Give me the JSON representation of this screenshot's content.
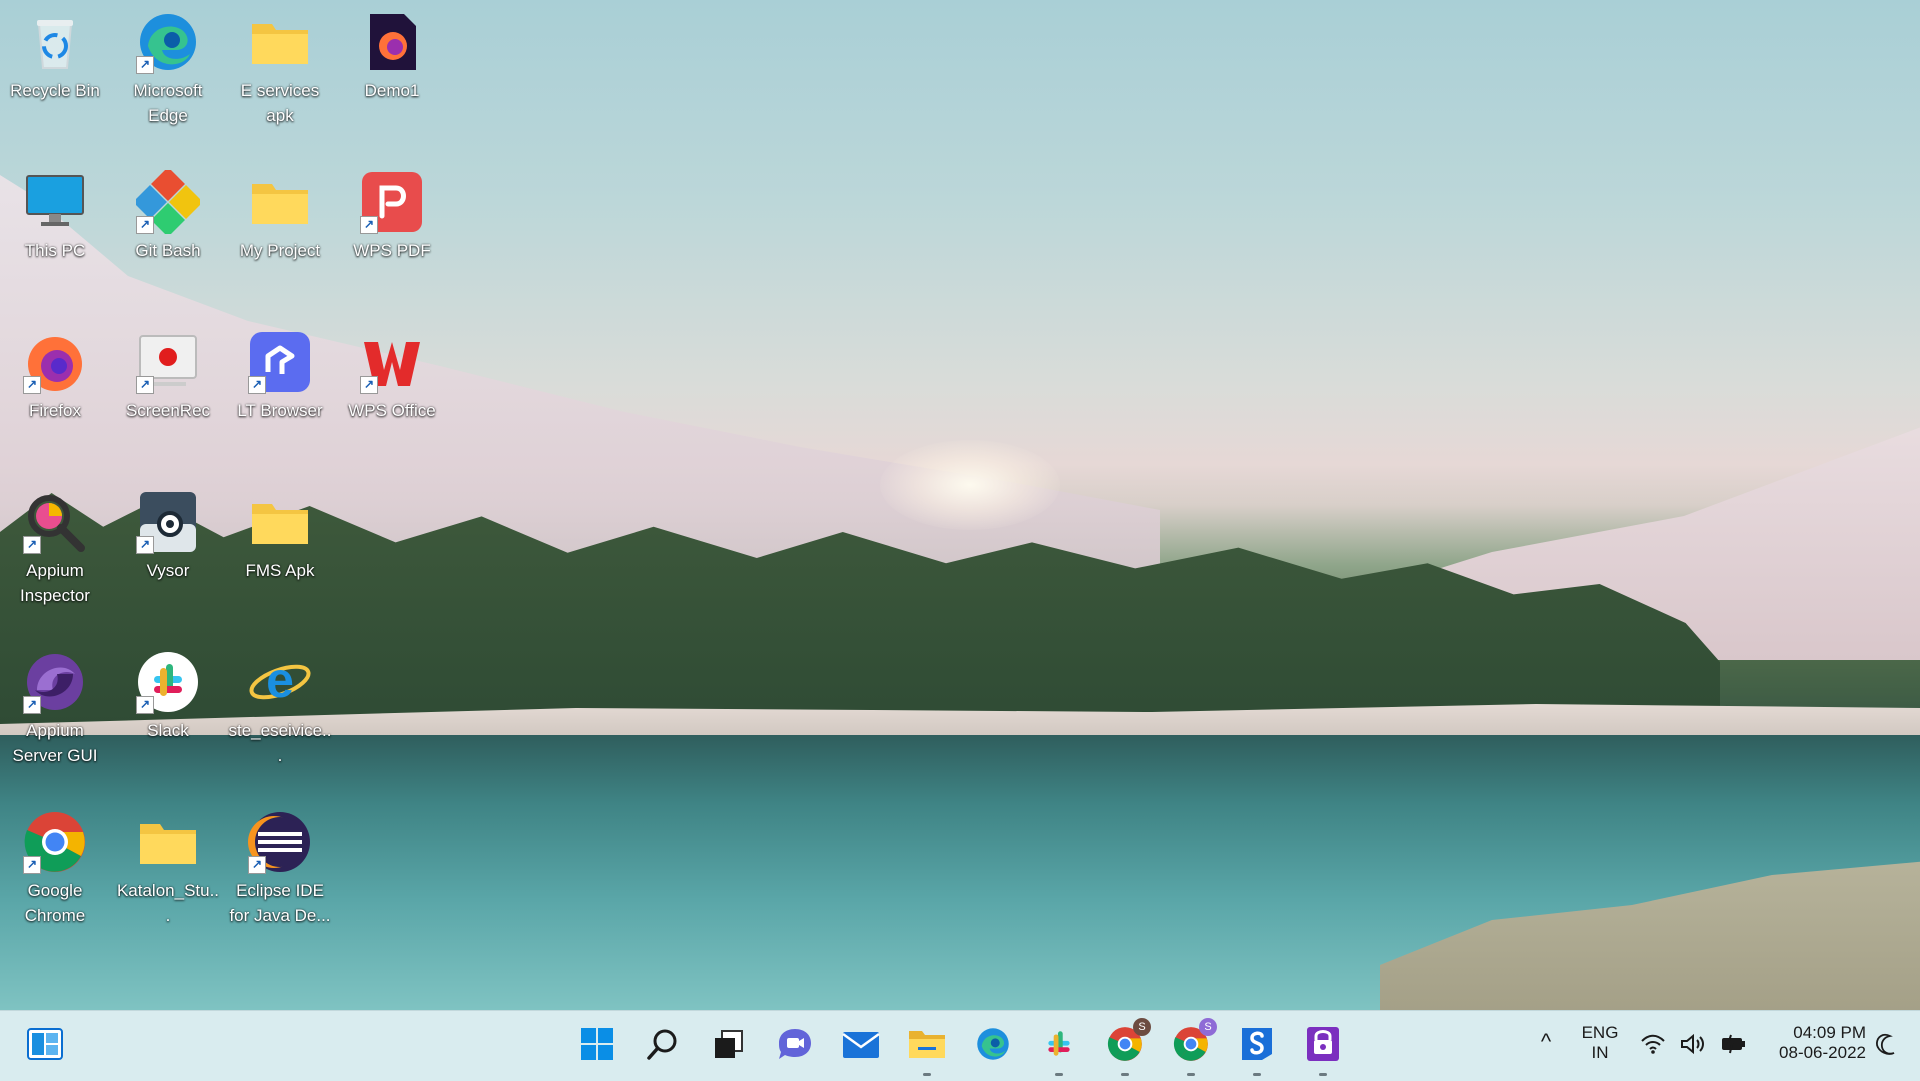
{
  "desktop": {
    "icons": [
      {
        "label": "Recycle Bin",
        "icon": "recycle-bin-icon"
      },
      {
        "label": "Microsoft Edge",
        "icon": "edge-icon"
      },
      {
        "label": "E services apk",
        "icon": "folder-icon"
      },
      {
        "label": "Demo1",
        "icon": "firefox-file-icon"
      },
      {
        "label": "This PC",
        "icon": "monitor-icon"
      },
      {
        "label": "Git Bash",
        "icon": "git-bash-icon"
      },
      {
        "label": "My Project",
        "icon": "folder-icon"
      },
      {
        "label": "WPS PDF",
        "icon": "wps-pdf-icon"
      },
      {
        "label": "Firefox",
        "icon": "firefox-icon"
      },
      {
        "label": "ScreenRec",
        "icon": "screenrec-icon"
      },
      {
        "label": "LT Browser",
        "icon": "lt-browser-icon"
      },
      {
        "label": "WPS Office",
        "icon": "wps-office-icon"
      },
      {
        "label": "Appium Inspector",
        "icon": "appium-inspector-icon"
      },
      {
        "label": "Vysor",
        "icon": "vysor-icon"
      },
      {
        "label": "FMS Apk",
        "icon": "folder-icon"
      },
      {
        "label": "Appium Server GUI",
        "icon": "appium-icon"
      },
      {
        "label": "Slack",
        "icon": "slack-icon"
      },
      {
        "label": "ste_eseivice...",
        "icon": "internet-explorer-icon"
      },
      {
        "label": "Google Chrome",
        "icon": "chrome-icon"
      },
      {
        "label": "Katalon_Stu...",
        "icon": "folder-icon"
      },
      {
        "label": "Eclipse IDE for Java De...",
        "icon": "eclipse-icon"
      }
    ]
  },
  "taskbar": {
    "apps": [
      "widgets-icon",
      "start-icon",
      "search-icon",
      "task-view-icon",
      "teams-chat-icon",
      "mail-icon",
      "file-explorer-icon",
      "edge-icon",
      "slack-icon",
      "chrome-profile-s-icon",
      "chrome-profile-s2-icon",
      "sentinel-app-icon",
      "purple-app-icon"
    ],
    "profile_badge_1": "S",
    "profile_badge_2": "S",
    "tray": {
      "chevron": "^",
      "lang_top": "ENG",
      "lang_bottom": "IN",
      "time": "04:09 PM",
      "date": "08-06-2022"
    }
  },
  "colors": {
    "taskbar": "#d9ecef",
    "accent_blue": "#0a6ed1"
  }
}
